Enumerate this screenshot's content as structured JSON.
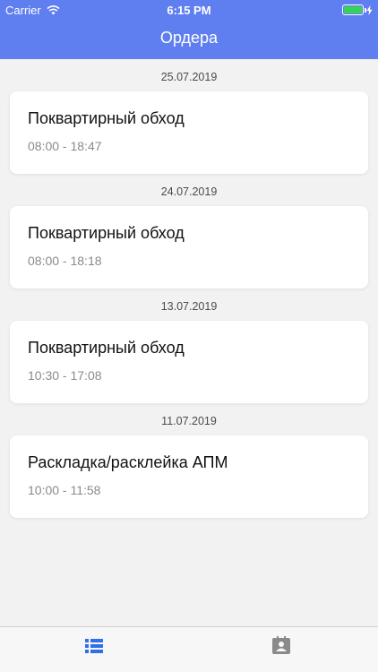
{
  "status_bar": {
    "carrier": "Carrier",
    "time": "6:15 PM"
  },
  "nav": {
    "title": "Ордера"
  },
  "orders": [
    {
      "date": "25.07.2019",
      "title": "Поквартирный обход",
      "time": "08:00 - 18:47"
    },
    {
      "date": "24.07.2019",
      "title": "Поквартирный обход",
      "time": "08:00 - 18:18"
    },
    {
      "date": "13.07.2019",
      "title": "Поквартирный обход",
      "time": "10:30 - 17:08"
    },
    {
      "date": "11.07.2019",
      "title": "Раскладка/расклейка АПМ",
      "time": "10:00 - 11:58"
    }
  ],
  "tabbar": {
    "items": [
      {
        "icon": "list-icon",
        "active": true,
        "color": "#2f6fe8"
      },
      {
        "icon": "contact-card-icon",
        "active": false,
        "color": "#8a8a8a"
      }
    ]
  },
  "colors": {
    "header": "#5f7ff0",
    "battery": "#38d15a",
    "background": "#f2f2f2"
  }
}
